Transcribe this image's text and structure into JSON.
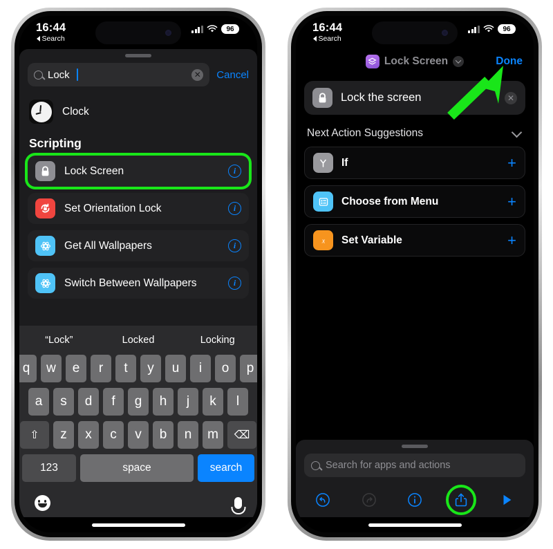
{
  "status_bar": {
    "time": "16:44",
    "back_label": "Search",
    "battery": "96"
  },
  "left_phone": {
    "search": {
      "value": "Lock",
      "cancel_label": "Cancel",
      "clear_glyph": "✕"
    },
    "app_result": {
      "label": "Clock"
    },
    "section_header": "Scripting",
    "actions": [
      {
        "label": "Lock Screen",
        "icon": "lock-icon",
        "icon_color": "#8e8e93",
        "highlighted": true
      },
      {
        "label": "Set Orientation Lock",
        "icon": "orientation-lock-icon",
        "icon_color": "#f0453f",
        "highlighted": false
      },
      {
        "label": "Get All Wallpapers",
        "icon": "wallpaper-icon",
        "icon_color": "#4fc3f7",
        "highlighted": false
      },
      {
        "label": "Switch Between Wallpapers",
        "icon": "wallpaper-icon",
        "icon_color": "#4fc3f7",
        "highlighted": false
      }
    ],
    "info_glyph": "i",
    "keyboard": {
      "predictions": [
        "“Lock”",
        "Locked",
        "Locking"
      ],
      "row1": [
        "q",
        "w",
        "e",
        "r",
        "t",
        "y",
        "u",
        "i",
        "o",
        "p"
      ],
      "row2": [
        "a",
        "s",
        "d",
        "f",
        "g",
        "h",
        "j",
        "k",
        "l"
      ],
      "row3": [
        "z",
        "x",
        "c",
        "v",
        "b",
        "n",
        "m"
      ],
      "shift_glyph": "⇧",
      "backspace_glyph": "⌫",
      "numbers_label": "123",
      "space_label": "space",
      "search_label": "search"
    }
  },
  "right_phone": {
    "nav": {
      "title": "Lock Screen",
      "done_label": "Done"
    },
    "step": {
      "label": "Lock the screen",
      "clear_glyph": "✕"
    },
    "suggestions_header": "Next Action Suggestions",
    "suggestions": [
      {
        "label": "If",
        "icon": "if-branch-icon",
        "icon_color": "#9a9a9e",
        "plus": "+"
      },
      {
        "label": "Choose from Menu",
        "icon": "menu-icon",
        "icon_color": "#4fc3f7",
        "plus": "+"
      },
      {
        "label": "Set Variable",
        "icon": "variable-icon",
        "icon_color": "#f7941e",
        "plus": "+"
      }
    ],
    "bottom_search_placeholder": "Search for apps and actions",
    "toolbar": [
      {
        "name": "undo",
        "color": "#0a84ff"
      },
      {
        "name": "redo",
        "color": "#3a3a3c"
      },
      {
        "name": "info",
        "color": "#0a84ff"
      },
      {
        "name": "share",
        "color": "#0a84ff",
        "highlighted": true
      },
      {
        "name": "play",
        "color": "#0a84ff"
      }
    ]
  },
  "annotations": {
    "highlight_color": "#19e619",
    "arrow_color": "#19e619"
  }
}
